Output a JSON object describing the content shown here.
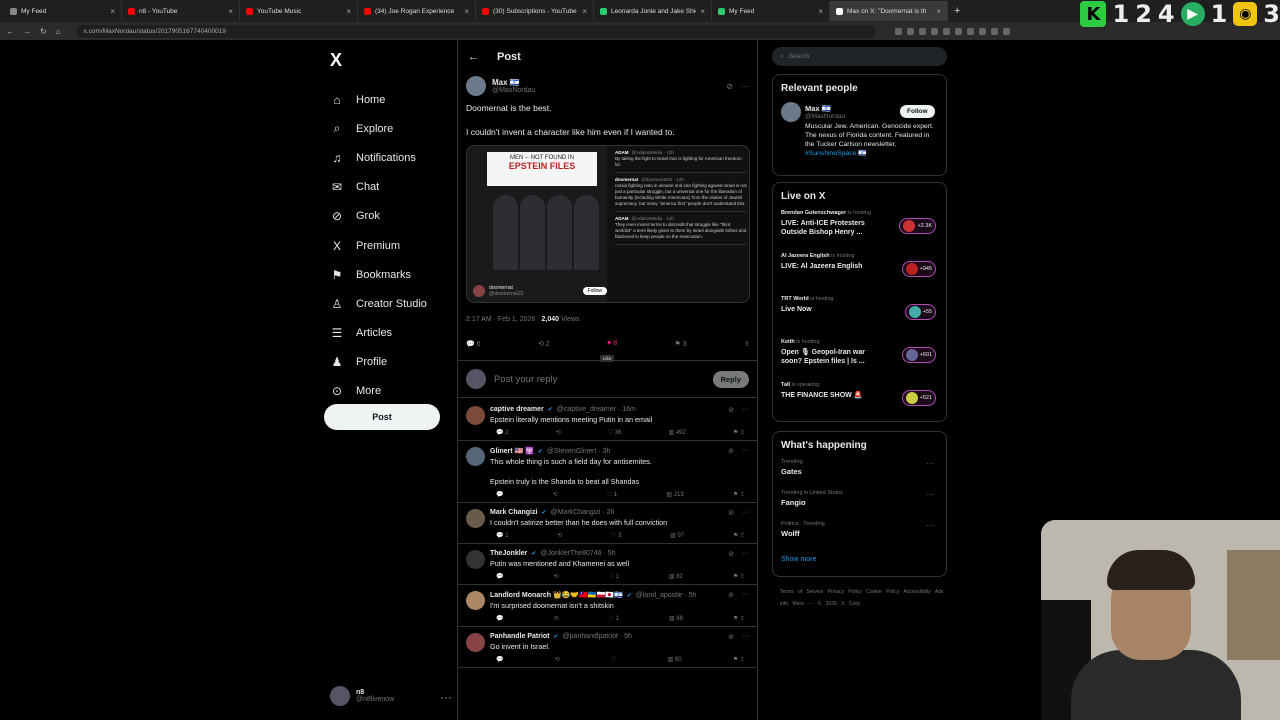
{
  "browser": {
    "tabs": [
      {
        "title": "My Feed",
        "color": "#888888"
      },
      {
        "title": "n8 - YouTube",
        "color": "#ff0000"
      },
      {
        "title": "YouTube Music",
        "color": "#ff0000"
      },
      {
        "title": "(34) Joe Rogan Experience",
        "color": "#ff0000"
      },
      {
        "title": "(30) Subscriptions - YouTube",
        "color": "#ff0000"
      },
      {
        "title": "Leonarda Jonie and Jake Shiel",
        "color": "#2ecc71"
      },
      {
        "title": "My Feed",
        "color": "#2ecc71"
      },
      {
        "title": "Max on X: \"Doomernat is th",
        "color": "#ffffff"
      }
    ],
    "url": "x.com/MaxNordau/status/2017905167740400019"
  },
  "overlay": {
    "k": "K",
    "n1": "1",
    "n2": "2",
    "n3": "4",
    "n4": "1",
    "n5": "3"
  },
  "nav": {
    "logo": "X",
    "items": [
      {
        "label": "Home",
        "icon": "home-icon",
        "glyph": "⌂"
      },
      {
        "label": "Explore",
        "icon": "search-icon",
        "glyph": "⌕"
      },
      {
        "label": "Notifications",
        "icon": "bell-icon",
        "glyph": "♫"
      },
      {
        "label": "Chat",
        "icon": "mail-icon",
        "glyph": "✉"
      },
      {
        "label": "Grok",
        "icon": "grok-icon",
        "glyph": "⊘"
      },
      {
        "label": "Premium",
        "icon": "x-icon",
        "glyph": "X"
      },
      {
        "label": "Bookmarks",
        "icon": "bookmark-icon",
        "glyph": "⚑"
      },
      {
        "label": "Creator Studio",
        "icon": "creator-icon",
        "glyph": "♙"
      },
      {
        "label": "Articles",
        "icon": "articles-icon",
        "glyph": "☰"
      },
      {
        "label": "Profile",
        "icon": "profile-icon",
        "glyph": "♟"
      },
      {
        "label": "More",
        "icon": "more-icon",
        "glyph": "⊙"
      }
    ],
    "post_label": "Post",
    "account": {
      "name": "n8",
      "handle": "@n8livenow"
    }
  },
  "post": {
    "header": "Post",
    "author": {
      "name": "Max 🇮🇱",
      "handle": "@MaxNordau"
    },
    "line1": "Doomernat is the best.",
    "line2": "I couldn't invent a character like him even if I wanted to.",
    "media": {
      "title_small": "MEN -- NOT FOUND IN",
      "title_big": "EPSTEIN FILES",
      "footer_name": "doomernat",
      "footer_handle": "@doomernat22",
      "follow": "Follow",
      "tweets": [
        {
          "name": "ADAM",
          "handle": "@AdamsMedia · 12h",
          "text": "By taking the fight to Israel Iran is fighting for American freedom lol."
        },
        {
          "name": "doomernat",
          "handle": "@doomernat22 · 12h",
          "text": "russia fighting nato in ukraine and iran fighting against israel is not just a particular struggle, but a universal one for the liberation of humanity (including White Americans) from the chains of Jewish supremacy. but many \"america first\" people don't understand this."
        },
        {
          "name": "ADAM",
          "handle": "@AdamsMedia · 12h",
          "text": "They even invent terms to discredit that struggle like \"third worldist\" a term likely given to them by Israel alongside bribes and blackmail to keep people on the reservation."
        }
      ]
    },
    "time": "2:17 AM · Feb 1, 2026 · ",
    "views": "2,040",
    "views_label": " Views",
    "actions": {
      "replies": "6",
      "reposts": "2",
      "likes": "8",
      "bookmarks": "3"
    },
    "like_tooltip": "Like",
    "reply_placeholder": "Post your reply",
    "reply_button": "Reply"
  },
  "comments": [
    {
      "name": "captive dreamer",
      "handle": "@captive_dreamer · 16m",
      "text": "Epstein literally mentions meeting Putin in an email",
      "text2": "",
      "replies": "2",
      "likes": "36",
      "views": "492",
      "avcolor": "#7a4a3a"
    },
    {
      "name": "Glinert 🇺🇸 🕎",
      "handle": "@StevenGlinert · 3h",
      "text": "This whole thing is such a field day for  antisemites.",
      "text2": "Epstein truly is the Shanda to beat all Shandas",
      "replies": "",
      "likes": "1",
      "views": "213",
      "avcolor": "#556677"
    },
    {
      "name": "Mark Changizi",
      "handle": "@MarkChangizi · 2h",
      "text": "I couldn't satirize better than he does with full conviction",
      "text2": "",
      "replies": "1",
      "likes": "3",
      "views": "97",
      "avcolor": "#6a5a4a"
    },
    {
      "name": "TheJonkler",
      "handle": "@JonklerThe80746 · 5h",
      "text": "Putin was mentioned and Khamenei as well",
      "text2": "",
      "replies": "",
      "likes": "1",
      "views": "82",
      "avcolor": "#333333"
    },
    {
      "name": "Landlord Monarch 👑😂🤝🇹🇼🇺🇦🇵🇱🇯🇵🇮🇱",
      "handle": "@land_apostle · 5h",
      "text": "I'm surprised doomernat isn't a shitskin",
      "text2": "",
      "replies": "",
      "likes": "1",
      "views": "88",
      "avcolor": "#aa8866"
    },
    {
      "name": "Panhandle Patriot",
      "handle": "@panhandlpatriot · 5h",
      "text": "Go invent in Israel.",
      "text2": "",
      "replies": "",
      "likes": "",
      "views": "60",
      "avcolor": "#884444"
    }
  ],
  "sidebar": {
    "search_placeholder": "Search",
    "relevant": {
      "title": "Relevant people",
      "name": "Max 🇮🇱",
      "handle": "@MaxNordau",
      "follow": "Follow",
      "bio": "Muscular Jew. American. Genocide expert. The nexus of Florida content. Featured in the Tucker Carlson newsletter. ",
      "tag": "#SunshineSpace 🇮🇱"
    },
    "live": {
      "title": "Live on X",
      "items": [
        {
          "host": "Brendan Gutenschwager",
          "status": " is hosting",
          "title": "LIVE: Anti-ICE Protesters Outside Bishop Henry ...",
          "count": "+2.3K"
        },
        {
          "host": "Al Jazeera English",
          "status": " is hosting",
          "title": "LIVE: Al Jazeera English",
          "count": "+945"
        },
        {
          "host": "TRT World",
          "status": " is hosting",
          "title": "Live Now",
          "count": "+55"
        },
        {
          "host": "Keith",
          "status": " is hosting",
          "title": "Open 🎙 Geopol-Iran war soon? Epstein files | Is ...",
          "count": "+601"
        },
        {
          "host": "Tall",
          "status": " is speaking",
          "title": "THE FINANCE SHOW 🚨",
          "count": "+521"
        }
      ]
    },
    "happening": {
      "title": "What's happening",
      "items": [
        {
          "category": "Trending",
          "name": "Gates"
        },
        {
          "category": "Trending in United States",
          "name": "Fangio"
        },
        {
          "category": "Politics · Trending",
          "name": "Wolff"
        }
      ],
      "show_more": "Show more"
    },
    "footer": "Terms of Service  Privacy Policy  Cookie Policy  Accessibility  Ads info  More ···  © 2026 X Corp."
  }
}
